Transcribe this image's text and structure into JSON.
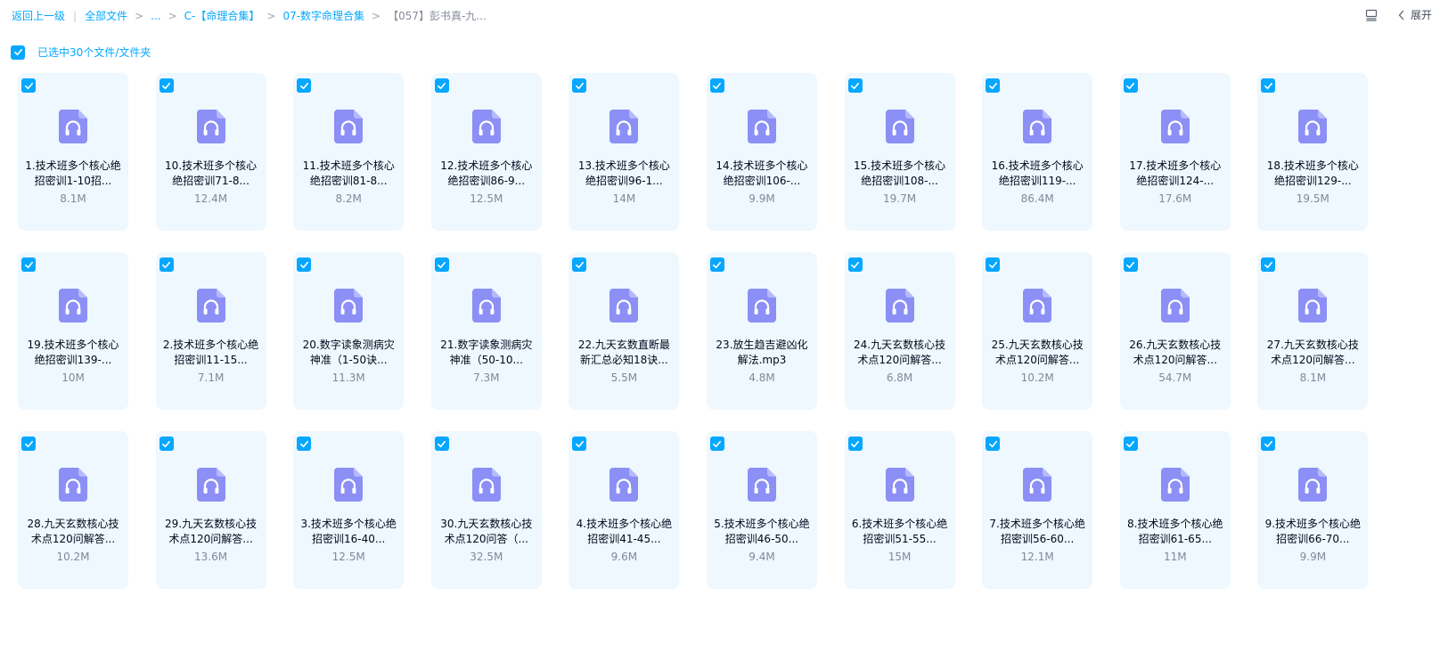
{
  "breadcrumb": {
    "back": "返回上一级",
    "items": [
      "全部文件",
      "...",
      "C-【命理合集】",
      "07-数字命理合集"
    ],
    "current": "【057】彭书真-九..."
  },
  "toolbar": {
    "expand_label": "展开"
  },
  "selection": {
    "label": "已选中30个文件/文件夹"
  },
  "colors": {
    "accent": "#06a7ff",
    "card_bg": "#eef8fe",
    "audio_icon": "#8b8ff6"
  },
  "files": [
    {
      "name": "1.技术班多个核心绝招密训1-10招...",
      "size": "8.1M",
      "icon": "audio-file-icon"
    },
    {
      "name": "10.技术班多个核心绝招密训71-8...",
      "size": "12.4M",
      "icon": "audio-file-icon"
    },
    {
      "name": "11.技术班多个核心绝招密训81-8...",
      "size": "8.2M",
      "icon": "audio-file-icon"
    },
    {
      "name": "12.技术班多个核心绝招密训86-9...",
      "size": "12.5M",
      "icon": "audio-file-icon"
    },
    {
      "name": "13.技术班多个核心绝招密训96-1...",
      "size": "14M",
      "icon": "audio-file-icon"
    },
    {
      "name": "14.技术班多个核心绝招密训106-...",
      "size": "9.9M",
      "icon": "audio-file-icon"
    },
    {
      "name": "15.技术班多个核心绝招密训108-...",
      "size": "19.7M",
      "icon": "audio-file-icon"
    },
    {
      "name": "16.技术班多个核心绝招密训119-...",
      "size": "86.4M",
      "icon": "audio-file-icon"
    },
    {
      "name": "17.技术班多个核心绝招密训124-...",
      "size": "17.6M",
      "icon": "audio-file-icon"
    },
    {
      "name": "18.技术班多个核心绝招密训129-...",
      "size": "19.5M",
      "icon": "audio-file-icon"
    },
    {
      "name": "19.技术班多个核心绝招密训139-...",
      "size": "10M",
      "icon": "audio-file-icon"
    },
    {
      "name": "2.技术班多个核心绝招密训11-15...",
      "size": "7.1M",
      "icon": "audio-file-icon"
    },
    {
      "name": "20.数字读象测病灾神准（1-50诀...",
      "size": "11.3M",
      "icon": "audio-file-icon"
    },
    {
      "name": "21.数字读象测病灾神准（50-10...",
      "size": "7.3M",
      "icon": "audio-file-icon"
    },
    {
      "name": "22.九天玄数直断最新汇总必知18诀...",
      "size": "5.5M",
      "icon": "audio-file-icon"
    },
    {
      "name": "23.放生趋吉避凶化解法.mp3",
      "size": "4.8M",
      "icon": "audio-file-icon"
    },
    {
      "name": "24.九天玄数核心技术点120问解答...",
      "size": "6.8M",
      "icon": "audio-file-icon"
    },
    {
      "name": "25.九天玄数核心技术点120问解答...",
      "size": "10.2M",
      "icon": "audio-file-icon"
    },
    {
      "name": "26.九天玄数核心技术点120问解答...",
      "size": "54.7M",
      "icon": "audio-file-icon"
    },
    {
      "name": "27.九天玄数核心技术点120问解答...",
      "size": "8.1M",
      "icon": "audio-file-icon"
    },
    {
      "name": "28.九天玄数核心技术点120问解答...",
      "size": "10.2M",
      "icon": "audio-file-icon"
    },
    {
      "name": "29.九天玄数核心技术点120问解答...",
      "size": "13.6M",
      "icon": "audio-file-icon"
    },
    {
      "name": "3.技术班多个核心绝招密训16-40...",
      "size": "12.5M",
      "icon": "audio-file-icon"
    },
    {
      "name": "30.九天玄数核心技术点120问答（...",
      "size": "32.5M",
      "icon": "audio-file-icon"
    },
    {
      "name": "4.技术班多个核心绝招密训41-45...",
      "size": "9.6M",
      "icon": "audio-file-icon"
    },
    {
      "name": "5.技术班多个核心绝招密训46-50...",
      "size": "9.4M",
      "icon": "audio-file-icon"
    },
    {
      "name": "6.技术班多个核心绝招密训51-55...",
      "size": "15M",
      "icon": "audio-file-icon"
    },
    {
      "name": "7.技术班多个核心绝招密训56-60...",
      "size": "12.1M",
      "icon": "audio-file-icon"
    },
    {
      "name": "8.技术班多个核心绝招密训61-65...",
      "size": "11M",
      "icon": "audio-file-icon"
    },
    {
      "name": "9.技术班多个核心绝招密训66-70...",
      "size": "9.9M",
      "icon": "audio-file-icon"
    }
  ]
}
